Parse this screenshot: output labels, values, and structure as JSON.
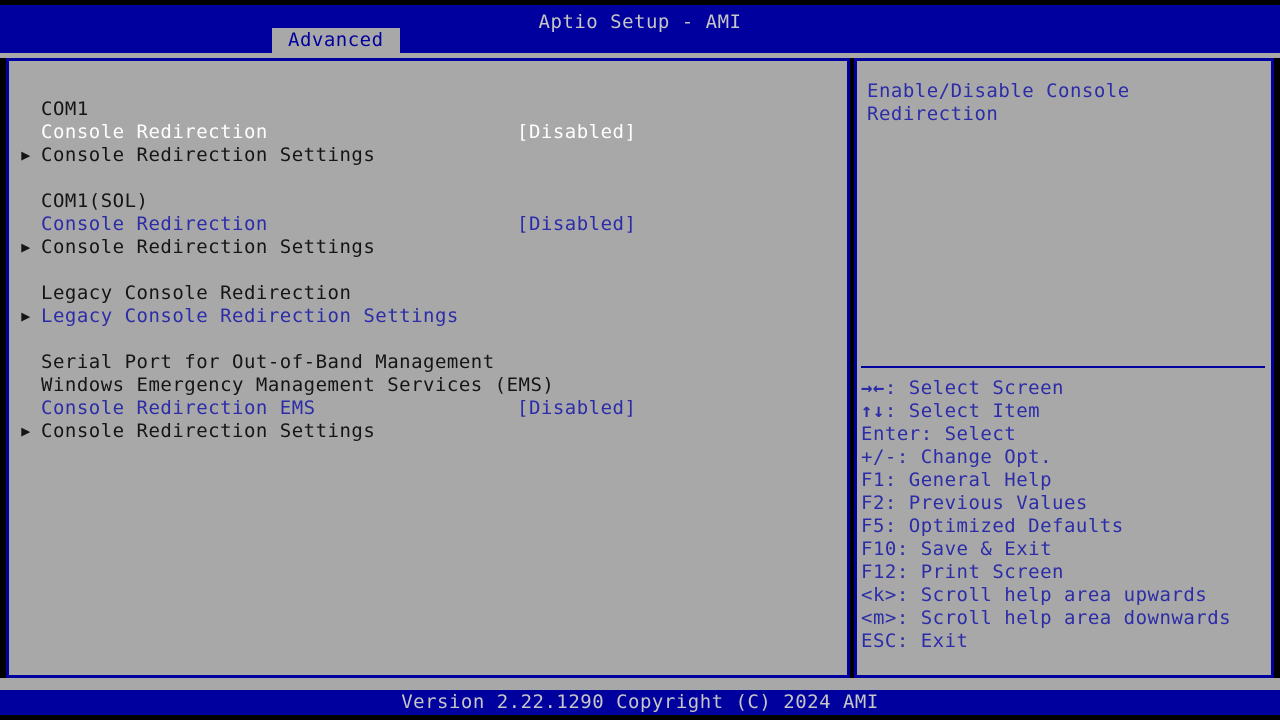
{
  "header": {
    "title": "Aptio Setup - AMI",
    "tabs": [
      {
        "label": "Advanced",
        "active": true
      }
    ]
  },
  "colors": {
    "header_blue": "#00009e",
    "panel_gray": "#a8a8a8",
    "text_blue": "#2c2ca8",
    "text_dark": "#151515",
    "text_white": "#ffffff",
    "footer_text": "#c6c6c6"
  },
  "main": {
    "rows": [
      {
        "arrow": "",
        "label": "COM1",
        "value": "",
        "label_color": "dark",
        "value_color": "dark",
        "interactable": false
      },
      {
        "arrow": "",
        "label": "Console Redirection",
        "value": "[Disabled]",
        "label_color": "white",
        "value_color": "white",
        "interactable": true
      },
      {
        "arrow": "▶",
        "label": "Console Redirection Settings",
        "value": "",
        "label_color": "dark",
        "value_color": "dark",
        "interactable": true
      },
      {
        "arrow": "",
        "label": "",
        "value": "",
        "label_color": "dark",
        "value_color": "dark",
        "interactable": false
      },
      {
        "arrow": "",
        "label": "COM1(SOL)",
        "value": "",
        "label_color": "dark",
        "value_color": "dark",
        "interactable": false
      },
      {
        "arrow": "",
        "label": "Console Redirection",
        "value": "[Disabled]",
        "label_color": "blue",
        "value_color": "blue",
        "interactable": true
      },
      {
        "arrow": "▶",
        "label": "Console Redirection Settings",
        "value": "",
        "label_color": "dark",
        "value_color": "dark",
        "interactable": true
      },
      {
        "arrow": "",
        "label": "",
        "value": "",
        "label_color": "dark",
        "value_color": "dark",
        "interactable": false
      },
      {
        "arrow": "",
        "label": "Legacy Console Redirection",
        "value": "",
        "label_color": "dark",
        "value_color": "dark",
        "interactable": false
      },
      {
        "arrow": "▶",
        "label": "Legacy Console Redirection Settings",
        "value": "",
        "label_color": "blue",
        "value_color": "blue",
        "interactable": true
      },
      {
        "arrow": "",
        "label": "",
        "value": "",
        "label_color": "dark",
        "value_color": "dark",
        "interactable": false
      },
      {
        "arrow": "",
        "label": "Serial Port for Out-of-Band Management",
        "value": "",
        "label_color": "dark",
        "value_color": "dark",
        "interactable": false
      },
      {
        "arrow": "",
        "label": "Windows Emergency Management Services (EMS)",
        "value": "",
        "label_color": "dark",
        "value_color": "dark",
        "interactable": false
      },
      {
        "arrow": "",
        "label": "Console Redirection EMS",
        "value": "[Disabled]",
        "label_color": "blue",
        "value_color": "blue",
        "interactable": true
      },
      {
        "arrow": "▶",
        "label": "Console Redirection Settings",
        "value": "",
        "label_color": "dark",
        "value_color": "dark",
        "interactable": true
      }
    ]
  },
  "help": {
    "lines": [
      "Enable/Disable Console",
      "Redirection"
    ]
  },
  "keys": [
    {
      "glyph": "→←",
      "text": ": Select Screen"
    },
    {
      "glyph": "↑↓",
      "text": ": Select Item"
    },
    {
      "glyph": "",
      "text": "Enter: Select"
    },
    {
      "glyph": "",
      "text": "+/-: Change Opt."
    },
    {
      "glyph": "",
      "text": "F1: General Help"
    },
    {
      "glyph": "",
      "text": "F2: Previous Values"
    },
    {
      "glyph": "",
      "text": "F5: Optimized Defaults"
    },
    {
      "glyph": "",
      "text": "F10: Save & Exit"
    },
    {
      "glyph": "",
      "text": "F12: Print Screen"
    },
    {
      "glyph": "",
      "text": "<k>: Scroll help area upwards"
    },
    {
      "glyph": "",
      "text": "<m>: Scroll help area downwards"
    },
    {
      "glyph": "",
      "text": "ESC: Exit"
    }
  ],
  "footer": {
    "version": "Version 2.22.1290 Copyright (C) 2024 AMI"
  }
}
